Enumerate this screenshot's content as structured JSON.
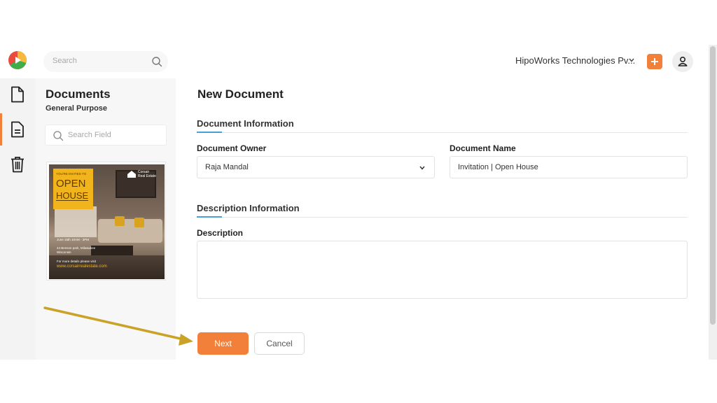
{
  "header": {
    "search_placeholder": "Search",
    "organization": "HipoWorks Technologies Pv...",
    "colors": {
      "accent": "#f2803a",
      "link": "#4a9fd8"
    }
  },
  "sidebar": {
    "items": [
      {
        "icon": "file-icon"
      },
      {
        "icon": "document-list-icon",
        "active": true
      },
      {
        "icon": "trash-icon"
      }
    ]
  },
  "documents_panel": {
    "title": "Documents",
    "subtitle": "General Purpose",
    "search_placeholder": "Search Field",
    "thumbnail": {
      "badge": "YOU'RE INVITED TO",
      "headline_1": "OPEN",
      "headline_2": "HOUSE",
      "brand_1": "Corsair",
      "brand_2": "Real Estate",
      "date": "June 15th 10AM - 3PM",
      "address_1": "44 Benson park, Milwaukee",
      "address_2": "Wisconsin",
      "details": "For more details please visit",
      "website": "www.corsairrealestate.com"
    }
  },
  "form": {
    "page_title": "New Document",
    "section_document": "Document Information",
    "owner_label": "Document Owner",
    "owner_value": "Raja Mandal",
    "name_label": "Document Name",
    "name_value": "Invitation | Open House",
    "section_description": "Description Information",
    "description_label": "Description",
    "description_value": "",
    "next_label": "Next",
    "cancel_label": "Cancel"
  }
}
